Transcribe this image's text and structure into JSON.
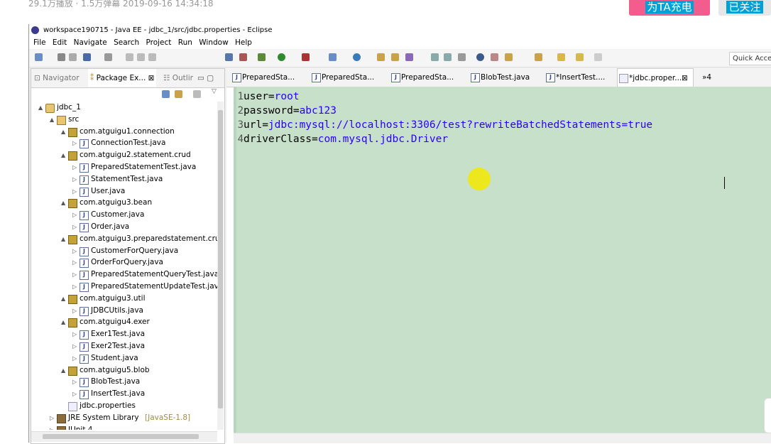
{
  "video": {
    "stats": "29.1万播放 · 1.5万弹幕   2019-09-16 14:34:18",
    "charge_label": "为TA充电",
    "follow_label": "已关注"
  },
  "window": {
    "title": "workspace190715 - Java EE - jdbc_1/src/jdbc.properties - Eclipse"
  },
  "menu": [
    "File",
    "Edit",
    "Navigate",
    "Search",
    "Project",
    "Run",
    "Window",
    "Help"
  ],
  "toolbar": {
    "quick_access_label": "Quick Acce"
  },
  "left_panel": {
    "tabs": {
      "navigator": "Navigator",
      "package_explorer": "Package Ex...",
      "package_explorer_close": "⊠",
      "outline": "Outlir"
    },
    "tree": [
      {
        "label": "jdbc_1",
        "icon": "project-icon",
        "level": 0,
        "twisty": "▲"
      },
      {
        "label": "src",
        "icon": "source-folder-icon",
        "level": 1,
        "twisty": "▲"
      },
      {
        "label": "com.atguigu1.connection",
        "icon": "package-icon",
        "level": 2,
        "twisty": "▲"
      },
      {
        "label": "ConnectionTest.java",
        "icon": "java-file-icon",
        "level": 3,
        "twisty": "▷"
      },
      {
        "label": "com.atguigu2.statement.crud",
        "icon": "package-icon",
        "level": 2,
        "twisty": "▲"
      },
      {
        "label": "PreparedStatementTest.java",
        "icon": "java-file-icon",
        "level": 3,
        "twisty": "▷"
      },
      {
        "label": "StatementTest.java",
        "icon": "java-file-icon",
        "level": 3,
        "twisty": "▷"
      },
      {
        "label": "User.java",
        "icon": "java-file-icon",
        "level": 3,
        "twisty": "▷"
      },
      {
        "label": "com.atguigu3.bean",
        "icon": "package-icon",
        "level": 2,
        "twisty": "▲"
      },
      {
        "label": "Customer.java",
        "icon": "java-file-icon",
        "level": 3,
        "twisty": "▷"
      },
      {
        "label": "Order.java",
        "icon": "java-file-icon",
        "level": 3,
        "twisty": "▷"
      },
      {
        "label": "com.atguigu3.preparedstatement.crud",
        "icon": "package-icon",
        "level": 2,
        "twisty": "▲"
      },
      {
        "label": "CustomerForQuery.java",
        "icon": "java-file-icon",
        "level": 3,
        "twisty": "▷"
      },
      {
        "label": "OrderForQuery.java",
        "icon": "java-file-icon",
        "level": 3,
        "twisty": "▷"
      },
      {
        "label": "PreparedStatementQueryTest.java",
        "icon": "java-file-icon",
        "level": 3,
        "twisty": "▷"
      },
      {
        "label": "PreparedStatementUpdateTest.java",
        "icon": "java-file-icon",
        "level": 3,
        "twisty": "▷"
      },
      {
        "label": "com.atguigu3.util",
        "icon": "package-icon",
        "level": 2,
        "twisty": "▲"
      },
      {
        "label": "JDBCUtils.java",
        "icon": "java-file-icon",
        "level": 3,
        "twisty": "▷"
      },
      {
        "label": "com.atguigu4.exer",
        "icon": "package-icon",
        "level": 2,
        "twisty": "▲"
      },
      {
        "label": "Exer1Test.java",
        "icon": "java-file-icon",
        "level": 3,
        "twisty": "▷"
      },
      {
        "label": "Exer2Test.java",
        "icon": "java-file-icon",
        "level": 3,
        "twisty": "▷"
      },
      {
        "label": "Student.java",
        "icon": "java-file-icon",
        "level": 3,
        "twisty": "▷"
      },
      {
        "label": "com.atguigu5.blob",
        "icon": "package-icon",
        "level": 2,
        "twisty": "▲"
      },
      {
        "label": "BlobTest.java",
        "icon": "java-file-icon",
        "level": 3,
        "twisty": "▷"
      },
      {
        "label": "InsertTest.java",
        "icon": "java-file-icon",
        "level": 3,
        "twisty": "▷"
      },
      {
        "label": "jdbc.properties",
        "icon": "properties-file-icon",
        "level": 2,
        "twisty": ""
      },
      {
        "label": "JRE System Library",
        "suffix": "[JavaSE-1.8]",
        "icon": "library-icon",
        "level": 1,
        "twisty": "▷"
      },
      {
        "label": "JUnit 4",
        "icon": "library-icon",
        "level": 1,
        "twisty": "▷"
      }
    ]
  },
  "editor": {
    "tabs": [
      {
        "label": "PreparedSta...",
        "active": false
      },
      {
        "label": "PreparedSta...",
        "active": false
      },
      {
        "label": "PreparedSta...",
        "active": false
      },
      {
        "label": "BlobTest.java",
        "active": false
      },
      {
        "label": "*InsertTest....",
        "active": false
      },
      {
        "label": "*jdbc.proper...",
        "active": true
      }
    ],
    "active_tab_close": "⊠",
    "overflow_label": "»4",
    "lines": [
      {
        "num": "1",
        "key": "user=",
        "value": "root"
      },
      {
        "num": "2",
        "key": "password=",
        "value": "abc123"
      },
      {
        "num": "3",
        "key": "url=",
        "value": "jdbc:mysql://localhost:3306/test?rewriteBatchedStatements=true"
      },
      {
        "num": "4",
        "key": "driverClass=",
        "value": "com.mysql.jdbc.Driver"
      }
    ]
  },
  "colors": {
    "editor_bg": "#c7e0c9",
    "value_text": "#2a00ff",
    "charge_button": "#f25d8e",
    "brand_blue": "#00a1d6"
  }
}
